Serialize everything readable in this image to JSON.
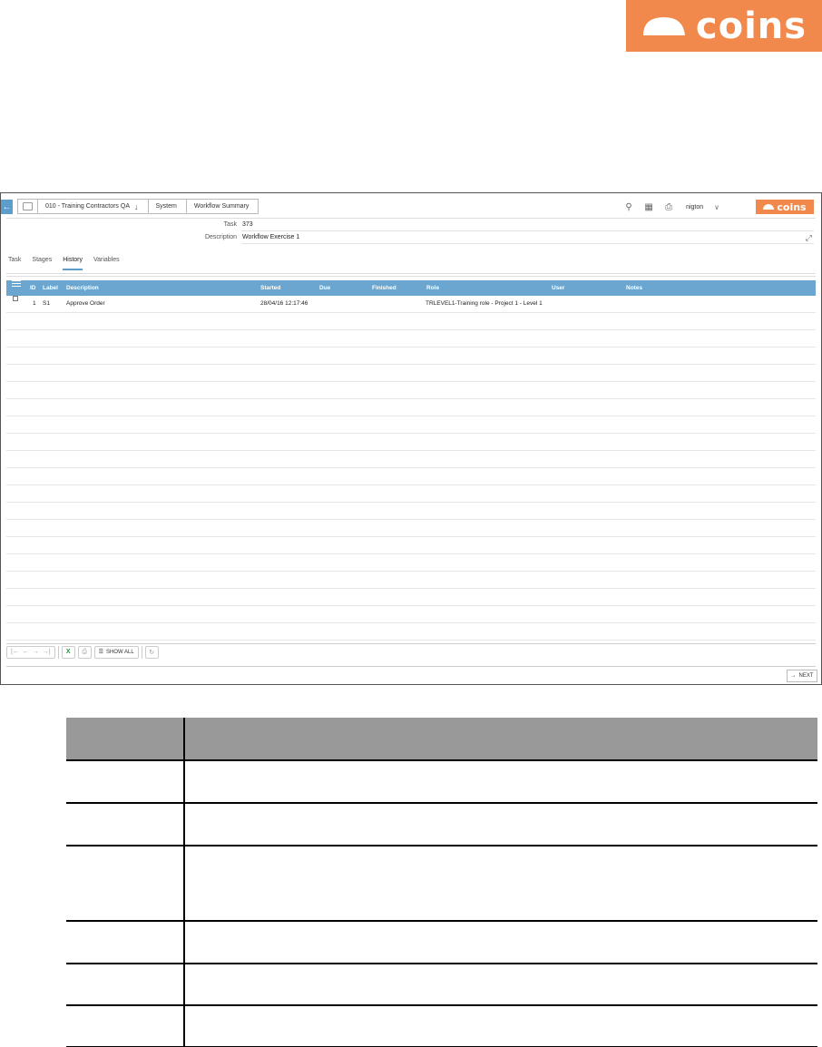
{
  "brand": {
    "name": "coins",
    "color": "#f0894b"
  },
  "window": {
    "breadcrumbs": [
      {
        "label": "",
        "icon": "home-box-icon"
      },
      {
        "label": "010 - Training Contractors QA",
        "icon": "arrow-down-icon"
      },
      {
        "label": "System"
      },
      {
        "label": "Workflow Summary"
      }
    ],
    "user": "nigton",
    "fields": {
      "task_label": "Task",
      "task_value": "373",
      "description_label": "Description",
      "description_value": "Workflow Exercise 1"
    },
    "tabs": [
      "Task",
      "Stages",
      "History",
      "Variables"
    ],
    "active_tab": "History",
    "grid": {
      "columns": [
        "ID",
        "Label",
        "Description",
        "Started",
        "Due",
        "Finished",
        "Role",
        "User",
        "Notes"
      ],
      "rows": [
        {
          "id": "1",
          "label": "S1",
          "description": "Approve Order",
          "started": "28/04/16 12:17:46",
          "due": "",
          "finished": "",
          "role": "TRLEVEL1-Training role - Project 1 - Level 1",
          "user": "",
          "notes": ""
        }
      ]
    },
    "toolbar": {
      "show_all": "SHOW ALL"
    },
    "next_label": "NEXT"
  },
  "accent_color": "#6aa6cf"
}
